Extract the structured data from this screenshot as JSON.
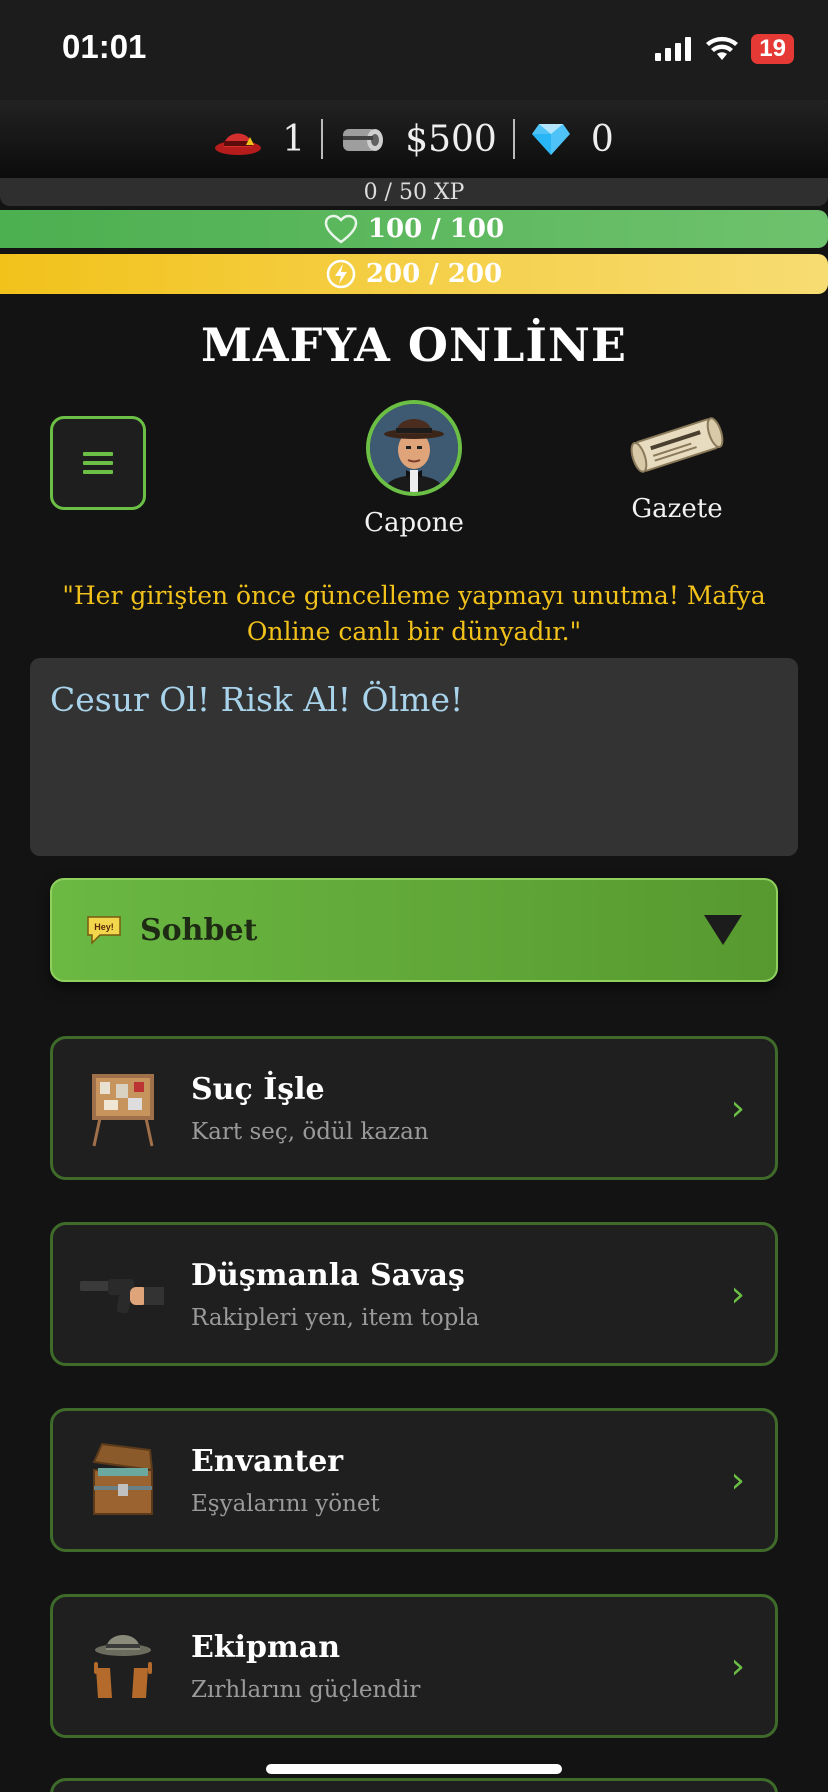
{
  "status_bar": {
    "time": "01:01",
    "battery": "19"
  },
  "currency": {
    "level": "1",
    "cash": "$500",
    "diamonds": "0"
  },
  "bars": {
    "xp": "0 / 50 XP",
    "xp_fraction": 0.0,
    "hp": "100 / 100",
    "hp_fraction": 1.0,
    "energy": "200 / 200",
    "energy_fraction": 1.0
  },
  "title": "MAFYA ONLİNE",
  "profile": {
    "name": "Capone"
  },
  "newspaper": {
    "label": "Gazete"
  },
  "tip": "\"Her girişten önce güncelleme yapmayı unutma! Mafya Online canlı bir dünyadır.\"",
  "motto": "Cesur Ol! Risk Al! Ölme!",
  "chat": {
    "label": "Sohbet",
    "icon_text": "Hey!"
  },
  "menu": [
    {
      "title": "Suç İşle",
      "subtitle": "Kart seç, ödül kazan"
    },
    {
      "title": "Düşmanla Savaş",
      "subtitle": "Rakipleri yen, item topla"
    },
    {
      "title": "Envanter",
      "subtitle": "Eşyalarını yönet"
    },
    {
      "title": "Ekipman",
      "subtitle": "Zırhlarını güçlendir"
    }
  ],
  "colors": {
    "accent_green": "#6bbf45",
    "hp_green": "#4caf50",
    "energy_yellow": "#f2c21b",
    "tip_yellow": "#f2c21b",
    "motto_blue": "#a8d3ea"
  }
}
